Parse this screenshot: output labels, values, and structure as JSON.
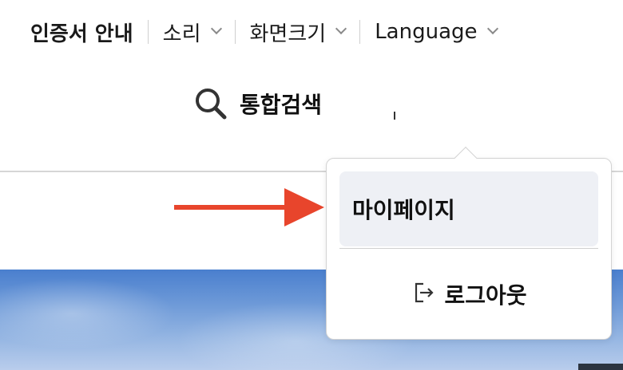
{
  "utility_nav": {
    "cert_guide": "인증서 안내",
    "sound": "소리",
    "screen_size": "화면크기",
    "language": "Language"
  },
  "search": {
    "label": "통합검색"
  },
  "user_menu": {
    "my_page": "마이페이지",
    "logout": "로그아웃"
  },
  "annotation": {
    "arrow_color": "#e8452c"
  }
}
